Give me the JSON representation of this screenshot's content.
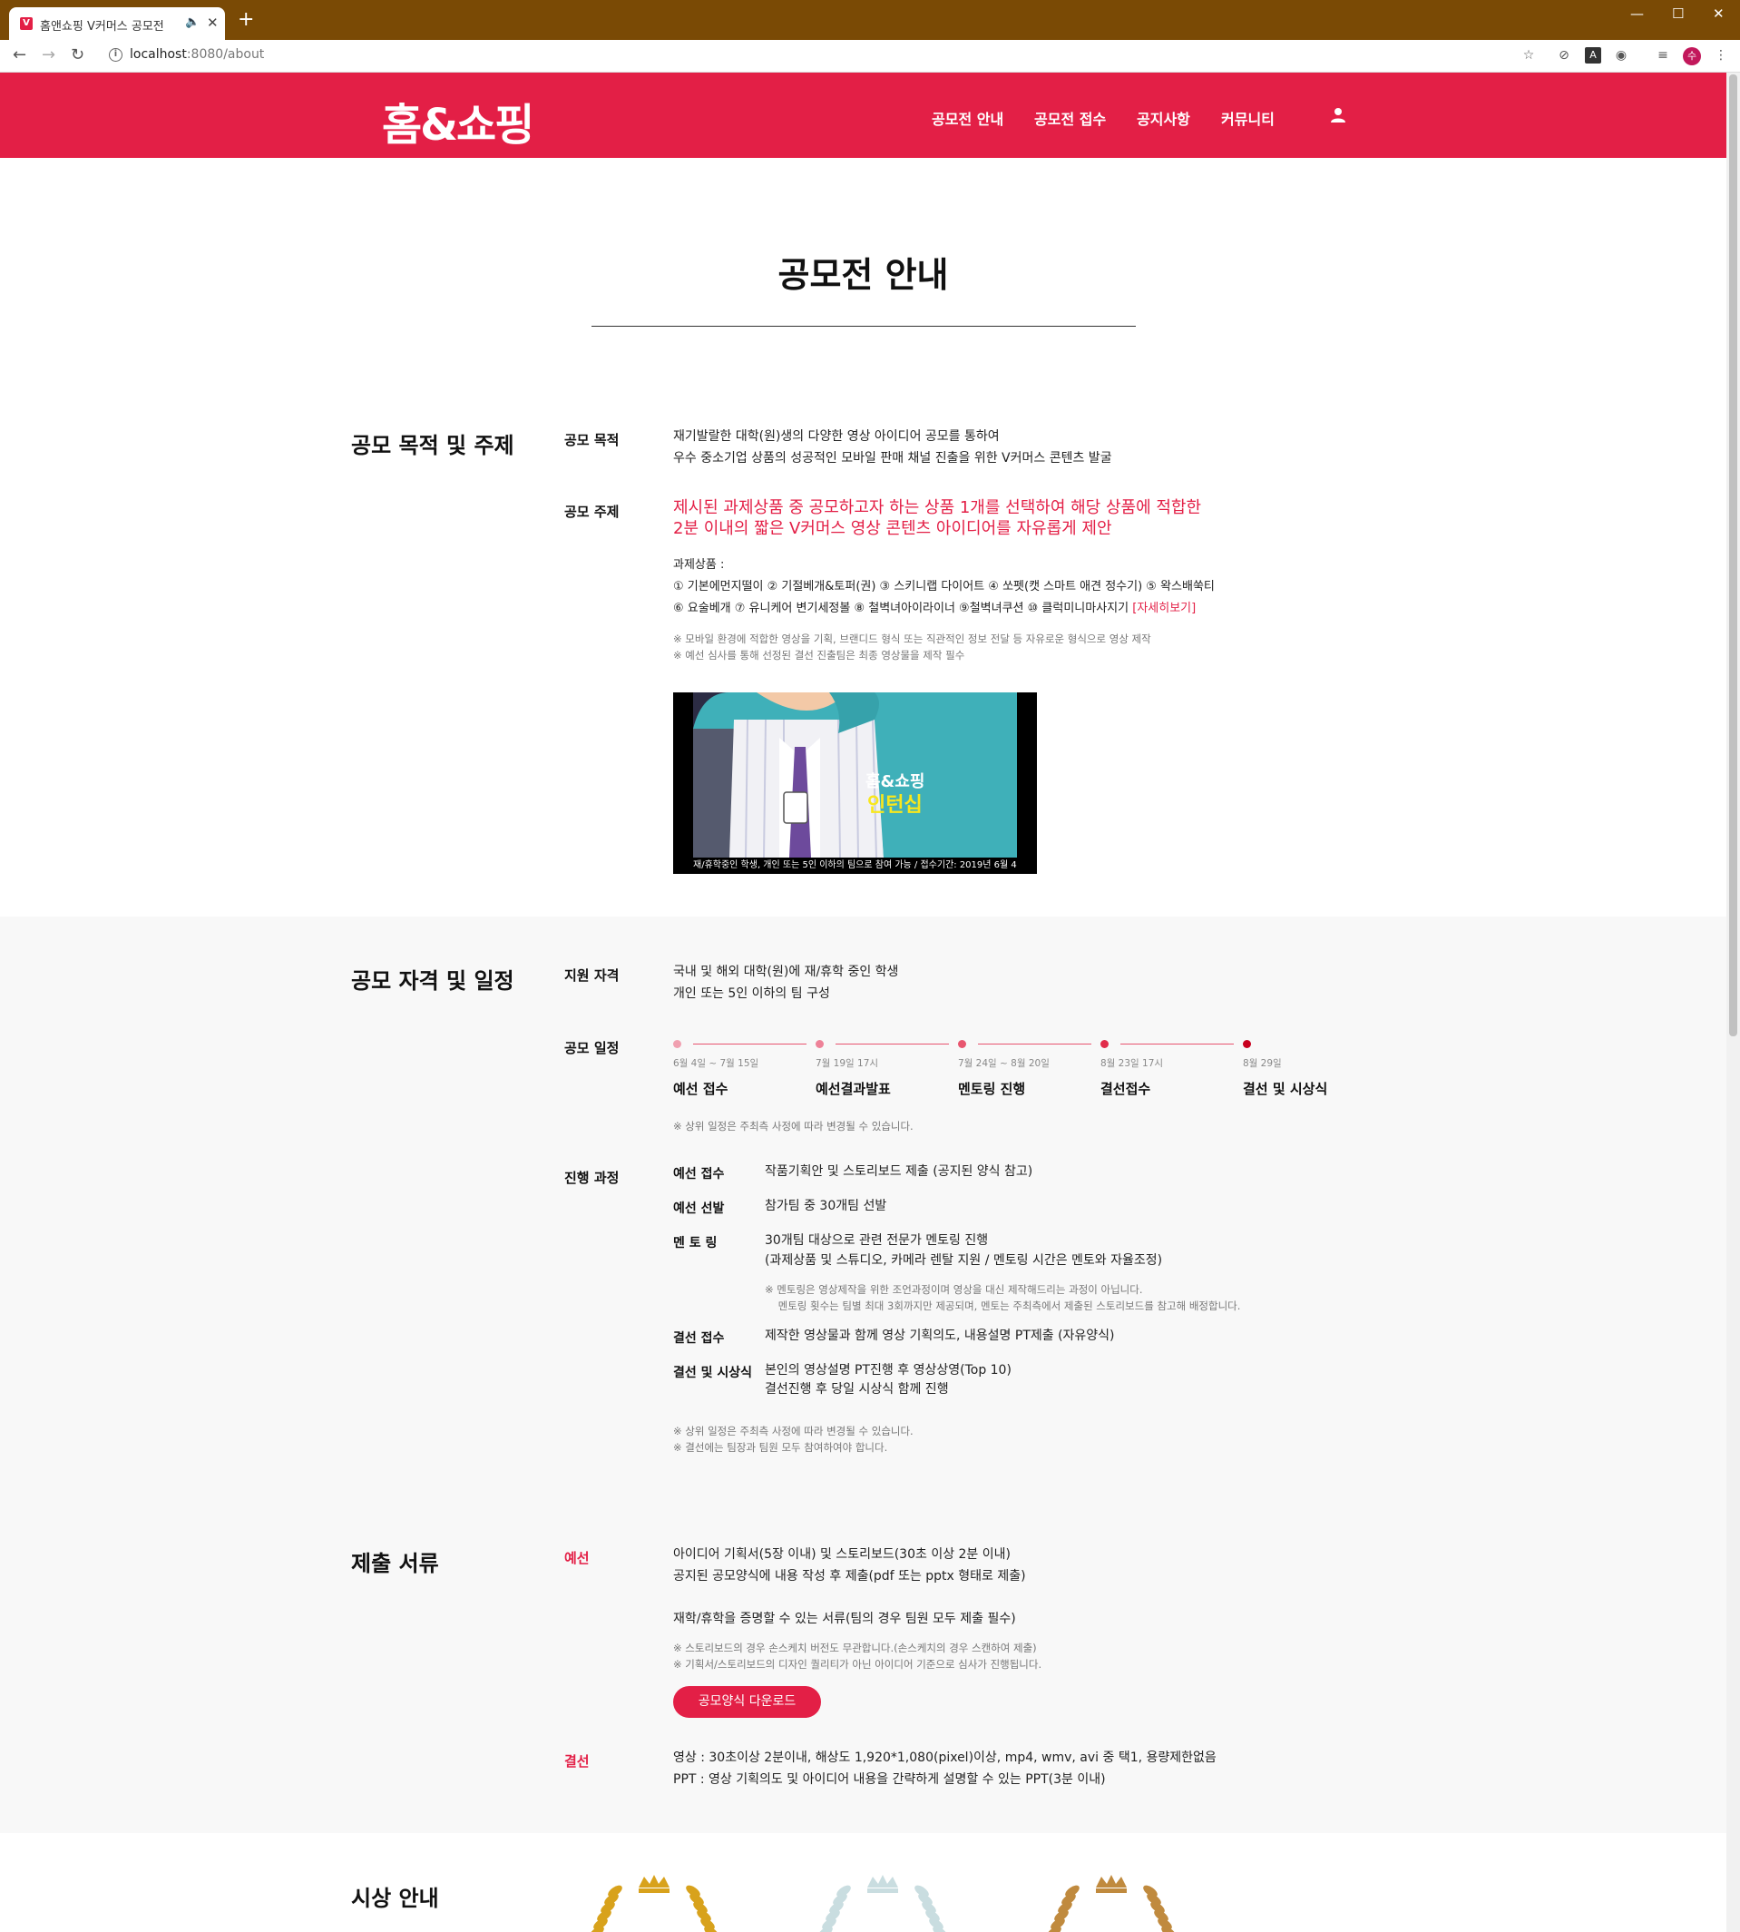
{
  "browser": {
    "tab_title": "홈앤쇼핑 V커머스 공모전",
    "url_host": "localhost",
    "url_rest": ":8080/about"
  },
  "header": {
    "logo": "홈&쇼핑",
    "nav": [
      "공모전 안내",
      "공모전 접수",
      "공지사항",
      "커뮤니티"
    ]
  },
  "page": {
    "title": "공모전 안내"
  },
  "purpose": {
    "title": "공모 목적 및 주제",
    "goal_label": "공모 목적",
    "goal_lines": [
      "재기발랄한 대학(원)생의 다양한 영상 아이디어 공모를 통하여",
      "우수 중소기업 상품의 성공적인 모바일 판매 채널 진출을 위한 V커머스 콘텐츠 발굴"
    ],
    "theme_label": "공모 주제",
    "theme_lines": [
      "제시된 과제상품 중 공모하고자 하는 상품 1개를 선택하여 해당 상품에 적합한",
      "2분 이내의 짧은 V커머스 영상 콘텐츠 아이디어를 자유롭게 제안"
    ],
    "products_heading": "과제상품 :",
    "products_line1": "① 기본에먼지떨이 ② 기절베개&토퍼(권) ③ 스키니랩 다이어트 ④ 쏘펫(캣 스마트 애견 정수기) ⑤ 왁스배쑥티",
    "products_line2": "⑥ 요술베개 ⑦ 유니케어 변기세정볼 ⑧ 철벽녀아이라이너 ⑨철벽녀쿠션 ⑩ 클럭미니마사지기 ",
    "products_more": "[자세히보기]",
    "notes": [
      "※ 모바일 환경에 적합한 영상을 기획, 브랜디드 형식 또는 직관적인 정보 전달 등 자유로운 형식으로 영상 제작",
      "※ 예선 심사를 통해 선정된 결선 진출팀은 최종 영상물을 제작 필수"
    ],
    "video_badge_1": "홈&쇼핑",
    "video_badge_2": "인턴십",
    "video_caption": "재/휴학중인 학생, 개인 또는 5인 이하의 팀으로 참여 가능 / 접수기간: 2019년 6월 4"
  },
  "eligibility": {
    "title": "공모 자격 및 일정",
    "elig_label": "지원 자격",
    "elig_lines": [
      "국내 및 해외 대학(원)에 재/휴학 중인 학생",
      "개인 또는 5인 이하의 팀 구성"
    ],
    "schedule_label": "공모 일정",
    "timeline": [
      {
        "date": "6월 4일 ~ 7월 15일",
        "name": "예선 접수",
        "color": "#f0a0b0"
      },
      {
        "date": "7월 19일 17시",
        "name": "예선결과발표",
        "color": "#ee8298"
      },
      {
        "date": "7월 24일 ~ 8월 20일",
        "name": "멘토링 진행",
        "color": "#e8566f"
      },
      {
        "date": "8월 23일 17시",
        "name": "결선접수",
        "color": "#e12c4a"
      },
      {
        "date": "8월 29일",
        "name": "결선 및 시상식",
        "color": "#c8001e"
      }
    ],
    "schedule_note": "※ 상위 일정은 주최측 사정에 따라 변경될 수 있습니다.",
    "process_label": "진행 과정",
    "process": [
      {
        "label": "예선 접수",
        "lines": [
          "작품기획안 및 스토리보드 제출 (공지된 양식 참고)"
        ]
      },
      {
        "label": "예선 선발",
        "lines": [
          "참가팀 중 30개팀 선발"
        ]
      },
      {
        "label": "멘 토 링",
        "lines": [
          "30개팀 대상으로 관련 전문가 멘토링 진행",
          "(과제상품 및 스튜디오, 카메라 렌탈 지원 / 멘토링 시간은 멘토와 자율조정)"
        ]
      },
      {
        "label": "결선 접수",
        "lines": [
          "제작한 영상물과 함께 영상 기획의도, 내용설명 PT제출 (자유양식)"
        ]
      },
      {
        "label": "결선 및 시상식",
        "lines": [
          "본인의 영상설명 PT진행 후 영상상영(Top 10)",
          "결선진행 후 당일 시상식 함께 진행"
        ]
      }
    ],
    "mentoring_notes": [
      "※ 멘토링은 영상제작을 위한 조언과정이며 영상을 대신 제작해드리는 과정이 아닙니다.",
      "    멘토링 횟수는 팀별 최대 3회까지만 제공되며, 멘토는 주최측에서 제출된 스토리보드를 참고해 배정합니다."
    ],
    "process_notes": [
      "※ 상위 일정은 주최측 사정에 따라 변경될 수 있습니다.",
      "※ 결선에는 팀장과 팀원 모두 참여하여야 합니다."
    ]
  },
  "documents": {
    "title": "제출 서류",
    "prelim_label": "예선",
    "prelim_lines": [
      "아이디어 기획서(5장 이내) 및 스토리보드(30초 이상 2분 이내)",
      "공지된 공모양식에 내용 작성 후 제출(pdf 또는 pptx 형태로 제출)"
    ],
    "proof_line": "재학/휴학을 증명할 수 있는 서류(팀의 경우 팀원 모두 제출 필수)",
    "notes": [
      "※ 스토리보드의 경우 손스케치 버전도 무관합니다.(손스케치의 경우 스캔하여 제출)",
      "※ 기획서/스토리보드의 디자인 퀄리티가 아닌 아이디어 기준으로 심사가 진행됩니다."
    ],
    "download_label": "공모양식 다운로드",
    "final_label": "결선",
    "final_lines": [
      "영상 : 30초이상 2분이내, 해상도 1,920*1,080(pixel)이상, mp4, wmv, avi 중 택1, 용량제한없음",
      "PPT : 영상 기획의도 및 아이디어 내용을 간략하게 설명할 수 있는 PPT(3분 이내)"
    ]
  },
  "awards": {
    "title": "시상 안내",
    "colors": [
      "#d8a21c",
      "#c9dde0",
      "#c08a3e"
    ]
  }
}
